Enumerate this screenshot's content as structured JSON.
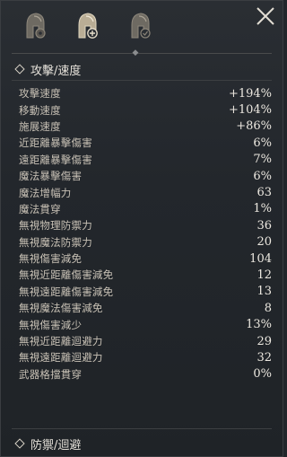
{
  "tabs": [
    {
      "icon": "helmet-gear-icon"
    },
    {
      "icon": "helmet-plus-icon",
      "active": true
    },
    {
      "icon": "helmet-shield-icon"
    }
  ],
  "close_icon": "close-icon",
  "section_attack": {
    "title": "攻擊/速度"
  },
  "stats": [
    {
      "label": "攻擊速度",
      "value": "+194%"
    },
    {
      "label": "移動速度",
      "value": "+104%"
    },
    {
      "label": "施展速度",
      "value": "+86%"
    },
    {
      "label": "近距離暴擊傷害",
      "value": "6%"
    },
    {
      "label": "遠距離暴擊傷害",
      "value": "7%"
    },
    {
      "label": "魔法暴擊傷害",
      "value": "6%"
    },
    {
      "label": "魔法增幅力",
      "value": "63"
    },
    {
      "label": "魔法貫穿",
      "value": "1%"
    },
    {
      "label": "無視物理防禦力",
      "value": "36"
    },
    {
      "label": "無視魔法防禦力",
      "value": "20"
    },
    {
      "label": "無視傷害減免",
      "value": "104"
    },
    {
      "label": "無視近距離傷害減免",
      "value": "12"
    },
    {
      "label": "無視遠距離傷害減免",
      "value": "13"
    },
    {
      "label": "無視魔法傷害減免",
      "value": "8"
    },
    {
      "label": "無視傷害減少",
      "value": "13%"
    },
    {
      "label": "無視近距離迴避力",
      "value": "29"
    },
    {
      "label": "無視遠距離迴避力",
      "value": "32"
    },
    {
      "label": "武器格擋貫穿",
      "value": "0%"
    }
  ],
  "section_defense": {
    "title": "防禦/迴避"
  }
}
